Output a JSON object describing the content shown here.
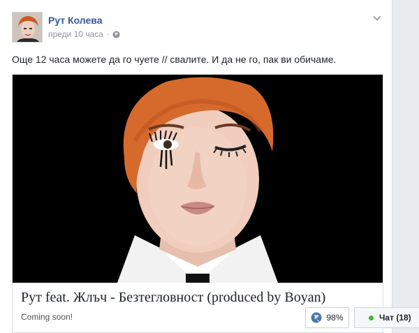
{
  "post": {
    "author": "Рут Колева",
    "time": "преди 10 часа",
    "text": "Още 12 часа можете да го чуете // свалите. И да не го, пак ви обичаме."
  },
  "link_preview": {
    "title": "Рут feat. Жлъч - Безтегловност (produced by Boyan)",
    "subtitle": "Coming soon!"
  },
  "zoom": {
    "value": "98%"
  },
  "chat": {
    "label": "Чат (18)"
  },
  "icons": {
    "privacy": "globe-icon",
    "options": "chevron-down-icon",
    "presence": "online-dot-icon"
  },
  "colors": {
    "link_blue": "#365899",
    "meta_gray": "#90949c",
    "online_green": "#42b72a",
    "page_bg": "#e9ebee"
  }
}
